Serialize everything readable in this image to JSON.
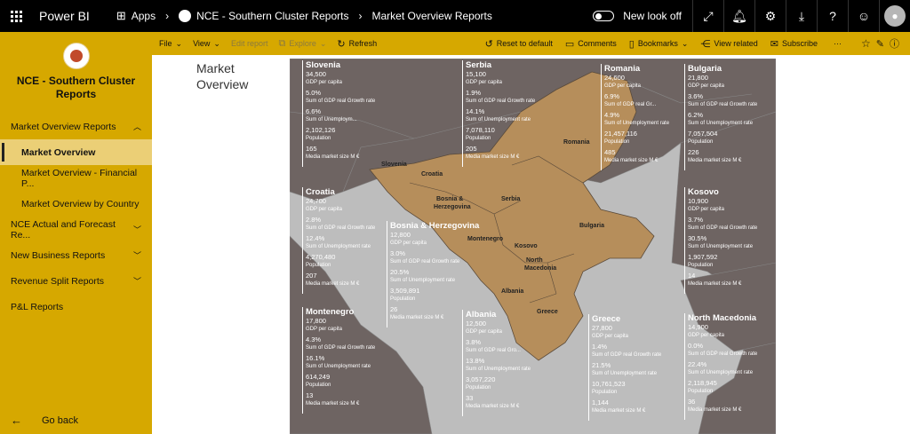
{
  "topbar": {
    "brand": "Power BI",
    "apps": "Apps",
    "workspace": "NCE - Southern Cluster Reports",
    "report": "Market Overview Reports",
    "new_look": "New look off"
  },
  "sidebar": {
    "title": "NCE - Southern Cluster Reports",
    "items": [
      {
        "label": "Market Overview Reports"
      },
      {
        "label": "Market Overview"
      },
      {
        "label": "Market Overview - Financial P..."
      },
      {
        "label": "Market Overview by Country"
      },
      {
        "label": "NCE Actual and Forecast Re..."
      },
      {
        "label": "New Business Reports"
      },
      {
        "label": "Revenue Split Reports"
      },
      {
        "label": "P&L Reports"
      }
    ],
    "go_back": "Go back"
  },
  "cmdbar": {
    "file": "File",
    "view": "View",
    "edit": "Edit report",
    "explore": "Explore",
    "refresh": "Refresh",
    "reset": "Reset to default",
    "comments": "Comments",
    "bookmarks": "Bookmarks",
    "related": "View related",
    "subscribe": "Subscribe"
  },
  "page": {
    "title_line1": "Market",
    "title_line2": "Overview"
  },
  "labels": {
    "gdp": "GDP per capita",
    "growth": "Sum of GDP real Growth rate",
    "growth_short": "Sum of GDP real Gro...",
    "growth_clip": "Sum of GDP real Gr...",
    "unemp": "Sum of Unemployment rate",
    "unemp_clip": "Sum of Unemploym...",
    "pop": "Population",
    "media": "Media market size M €"
  },
  "map_labels": {
    "slovenia": "Slovenia",
    "croatia": "Croatia",
    "bosnia1": "Bosnia &",
    "bosnia2": "Herzegovina",
    "serbia": "Serbia",
    "romania": "Romania",
    "bulgaria": "Bulgaria",
    "montenegro": "Montenegro",
    "kosovo": "Kosovo",
    "nm1": "North",
    "nm2": "Macedonia",
    "albania": "Albania",
    "greece": "Greece"
  },
  "countries": {
    "slovenia": {
      "name": "Slovenia",
      "gdp": "34,500",
      "growth": "5.0%",
      "unemp": "6.6%",
      "pop": "2,102,126",
      "media": "165"
    },
    "serbia": {
      "name": "Serbia",
      "gdp": "15,100",
      "growth": "1.9%",
      "unemp": "14.1%",
      "pop": "7,078,110",
      "media": "205"
    },
    "romania": {
      "name": "Romania",
      "gdp": "24,600",
      "growth": "6.9%",
      "unemp": "4.9%",
      "pop": "21,457,116",
      "media": "485"
    },
    "bulgaria": {
      "name": "Bulgaria",
      "gdp": "21,800",
      "growth": "3.6%",
      "unemp": "6.2%",
      "pop": "7,057,504",
      "media": "226"
    },
    "croatia": {
      "name": "Croatia",
      "gdp": "24,700",
      "growth": "2.8%",
      "unemp": "12.4%",
      "pop": "4,270,480",
      "media": "207"
    },
    "bosnia": {
      "name": "Bosnia & Herzegovina",
      "gdp": "12,800",
      "growth": "3.0%",
      "unemp": "20.5%",
      "pop": "3,509,891",
      "media": "26"
    },
    "kosovo": {
      "name": "Kosovo",
      "gdp": "10,900",
      "growth": "3.7%",
      "unemp": "30.5%",
      "pop": "1,907,592",
      "media": "14"
    },
    "montenegro": {
      "name": "Montenegro",
      "gdp": "17,800",
      "growth": "4.3%",
      "unemp": "16.1%",
      "pop": "614,249",
      "media": "13"
    },
    "albania": {
      "name": "Albania",
      "gdp": "12,500",
      "growth": "3.8%",
      "unemp": "13.8%",
      "pop": "3,057,220",
      "media": "33"
    },
    "greece": {
      "name": "Greece",
      "gdp": "27,800",
      "growth": "1.4%",
      "unemp": "21.5%",
      "pop": "10,761,523",
      "media": "1,144"
    },
    "north_macedonia": {
      "name": "North Macedonia",
      "gdp": "14,900",
      "growth": "0.0%",
      "unemp": "22.4%",
      "pop": "2,118,945",
      "media": "36"
    }
  },
  "colors": {
    "accent": "#d6a800",
    "map_sea": "#bdbdbd",
    "map_land": "#6e6462",
    "map_highlight": "#b68e5b"
  }
}
